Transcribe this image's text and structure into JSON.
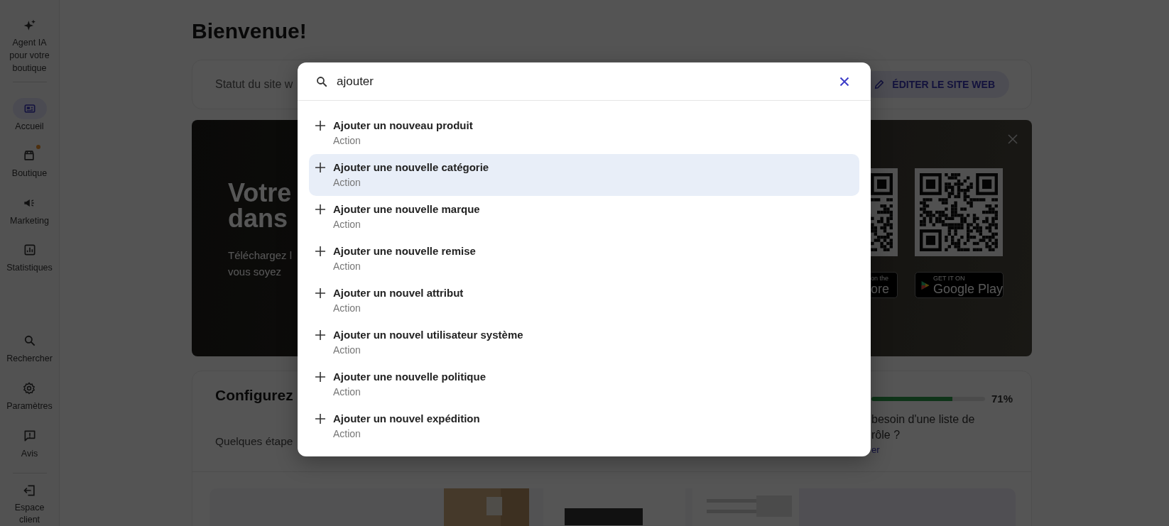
{
  "sidebar": {
    "top_item": {
      "label": "Agent IA pour votre boutique"
    },
    "items": [
      {
        "label": "Accueil",
        "selected": true,
        "badge": false
      },
      {
        "label": "Boutique",
        "selected": false,
        "badge": true
      },
      {
        "label": "Marketing",
        "selected": false,
        "badge": false
      },
      {
        "label": "Statistiques",
        "selected": false,
        "badge": false
      }
    ],
    "bottom_items": [
      {
        "label": "Rechercher",
        "selected": false,
        "badge": false
      },
      {
        "label": "Paramètres",
        "selected": false,
        "badge": false
      },
      {
        "label": "Avis",
        "selected": false,
        "badge": false
      }
    ],
    "exit_item": {
      "label": "Espace client"
    }
  },
  "page": {
    "title": "Bienvenue!",
    "site_status": {
      "label": "Statut du site w",
      "button": "ÉDITER LE SITE WEB"
    },
    "banner": {
      "headline_lines": [
        "Votre",
        "dans"
      ],
      "text_lines": [
        "Téléchargez l",
        "vous soyez"
      ],
      "app_store": {
        "line_1": "on the",
        "line_2": "ore"
      },
      "google_play": {
        "line_1": "GET IT ON",
        "line_2": "Google Play"
      }
    },
    "setup": {
      "title": "Configurez",
      "subtitle": "Quelques étape",
      "progress": {
        "level": 0.71,
        "reading": "71%"
      },
      "help_lines": [
        "besoin d'une liste de",
        "rôle ?"
      ],
      "link": "er"
    }
  },
  "search_dialog": {
    "query": "ajouter",
    "results": [
      {
        "title": "Ajouter un nouveau produit",
        "type": "Action",
        "selected": false
      },
      {
        "title": "Ajouter une nouvelle catégorie",
        "type": "Action",
        "selected": true
      },
      {
        "title": "Ajouter une nouvelle marque",
        "type": "Action",
        "selected": false
      },
      {
        "title": "Ajouter une nouvelle remise",
        "type": "Action",
        "selected": false
      },
      {
        "title": "Ajouter un nouvel attribut",
        "type": "Action",
        "selected": false
      },
      {
        "title": "Ajouter un nouvel utilisateur système",
        "type": "Action",
        "selected": false
      },
      {
        "title": "Ajouter une nouvelle politique",
        "type": "Action",
        "selected": false
      },
      {
        "title": "Ajouter un nouvel expédition",
        "type": "Action",
        "selected": false
      }
    ]
  }
}
